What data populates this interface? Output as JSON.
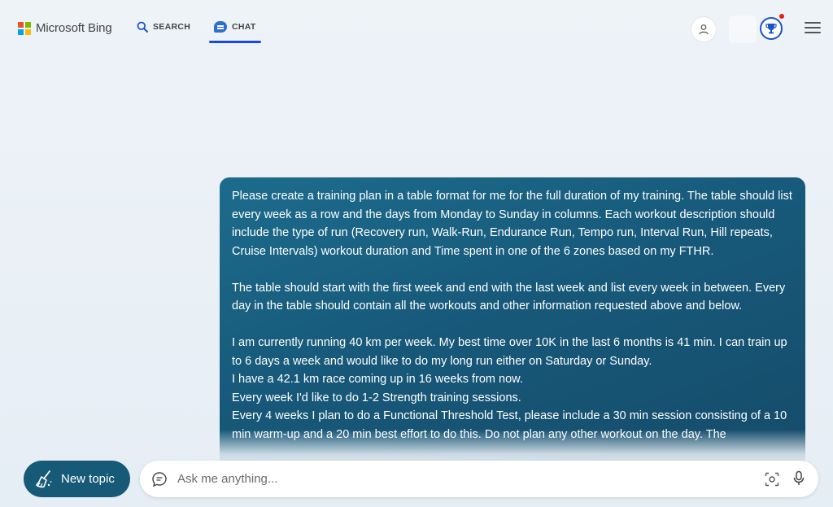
{
  "header": {
    "logo_text": "Microsoft Bing",
    "nav": [
      {
        "label": "SEARCH",
        "icon": "search-icon"
      },
      {
        "label": "CHAT",
        "icon": "chat-icon",
        "active": true
      }
    ],
    "accent_color": "#174ae4"
  },
  "message": {
    "paragraphs": [
      "Please create a training plan in a table format for me for the full duration of my training. The table should list every week as a row and the days from Monday to Sunday in columns. Each workout description should include the type of run (Recovery run, Walk-Run, Endurance Run, Tempo run, Interval Run, Hill repeats, Cruise Intervals) workout duration and Time spent in one of the 6 zones based on my FTHR.",
      "The table should start with the first week and end with the last week and list every week in between. Every day in the table should contain all the workouts and other information requested above and below.",
      "I am currently running 40 km per week. My best time  over 10K in the last 6 months is 41 min. I can train up to 6 days a week and would like to do my long run either on Saturday or Sunday.",
      "I have a 42.1 km race coming up in 16 weeks from now.",
      "Every week I'd like to do 1-2 Strength training sessions.",
      "Every 4 weeks I plan to do a Functional Threshold Test, please include a 30 min session consisting of a 10 min warm-up and a 20 min best effort to do this. Do not plan any other workout on the day. The"
    ],
    "bubble_color": "#17597a"
  },
  "composer": {
    "new_topic_label": "New topic",
    "placeholder": "Ask me anything..."
  }
}
